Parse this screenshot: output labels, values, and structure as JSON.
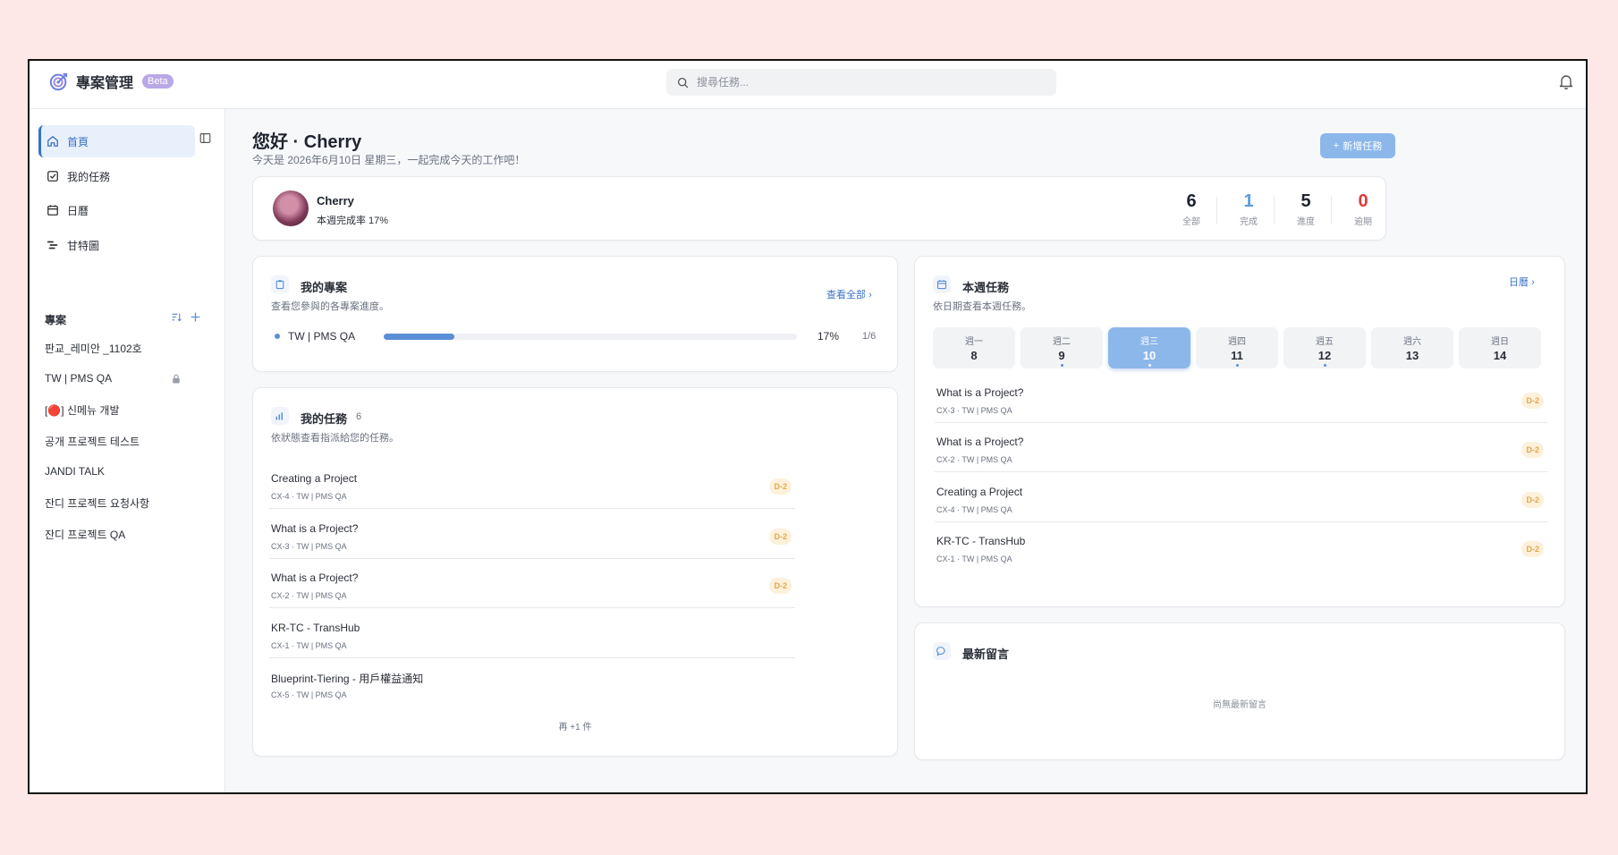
{
  "app": {
    "title": "專案管理",
    "badge": "Beta"
  },
  "search": {
    "placeholder": "搜尋任務..."
  },
  "sidebar": {
    "nav": [
      {
        "label": "首頁",
        "icon": "home-icon"
      },
      {
        "label": "我的任務",
        "icon": "check-square-icon"
      },
      {
        "label": "日曆",
        "icon": "calendar-icon"
      },
      {
        "label": "甘特圖",
        "icon": "gantt-icon"
      }
    ],
    "projects_title": "專案",
    "projects": [
      "판교_레미안 _1102호",
      "TW | PMS QA",
      "[🔴] 신메뉴 개발",
      "공개 프로젝트 테스트",
      "JANDI TALK",
      "잔디 프로젝트 요청사항",
      "잔디 프로젝트 QA"
    ]
  },
  "greeting": {
    "title": "您好 · Cherry",
    "subtitle": "今天是 2026年6月10日 星期三，一起完成今天的工作吧！",
    "new_task": "新增任務"
  },
  "profile": {
    "name": "Cherry",
    "rate": "本週完成率 17%",
    "stats": [
      {
        "value": "6",
        "label": "全部",
        "color": "#1f2430"
      },
      {
        "value": "1",
        "label": "完成",
        "color": "#5a9be0"
      },
      {
        "value": "5",
        "label": "進度",
        "color": "#1f2430"
      },
      {
        "value": "0",
        "label": "逾期",
        "color": "#e53935"
      }
    ]
  },
  "my_projects": {
    "title": "我的專案",
    "subtitle": "查看您參與的各專案進度。",
    "view_all": "查看全部",
    "items": [
      {
        "name": "TW | PMS QA",
        "progress": 0.17,
        "percent": "17%",
        "count": "1/6"
      }
    ]
  },
  "my_tasks": {
    "title": "我的任務",
    "count": "6",
    "subtitle": "依狀態查看指派給您的任務。",
    "items": [
      {
        "title": "Creating a Project",
        "meta": "CX-4 · TW | PMS QA",
        "badge": "D-2"
      },
      {
        "title": "What is a Project?",
        "meta": "CX-3 · TW | PMS QA",
        "badge": "D-2"
      },
      {
        "title": "What is a Project?",
        "meta": "CX-2 · TW | PMS QA",
        "badge": "D-2"
      },
      {
        "title": "KR-TC - TransHub",
        "meta": "CX-1 · TW | PMS QA",
        "badge": ""
      },
      {
        "title": "Blueprint-Tiering - 用戶權益通知",
        "meta": "CX-5 · TW | PMS QA",
        "badge": ""
      }
    ],
    "more": "再 +1 件"
  },
  "week_tasks": {
    "title": "本週任務",
    "subtitle": "依日期查看本週任務。",
    "calendar_link": "日曆",
    "days": [
      {
        "name": "週一",
        "date": "8",
        "dot": false,
        "selected": false
      },
      {
        "name": "週二",
        "date": "9",
        "dot": true,
        "selected": false
      },
      {
        "name": "週三",
        "date": "10",
        "dot": true,
        "selected": true
      },
      {
        "name": "週四",
        "date": "11",
        "dot": true,
        "selected": false
      },
      {
        "name": "週五",
        "date": "12",
        "dot": true,
        "selected": false
      },
      {
        "name": "週六",
        "date": "13",
        "dot": false,
        "selected": false
      },
      {
        "name": "週日",
        "date": "14",
        "dot": false,
        "selected": false
      }
    ],
    "items": [
      {
        "title": "What is a Project?",
        "meta": "CX-3 · TW | PMS QA",
        "badge": "D-2"
      },
      {
        "title": "What is a Project?",
        "meta": "CX-2 · TW | PMS QA",
        "badge": "D-2"
      },
      {
        "title": "Creating a Project",
        "meta": "CX-4 · TW | PMS QA",
        "badge": "D-2"
      },
      {
        "title": "KR-TC - TransHub",
        "meta": "CX-1 · TW | PMS QA",
        "badge": "D-2"
      }
    ]
  },
  "comments": {
    "title": "最新留言",
    "empty": "尚無最新留言"
  }
}
